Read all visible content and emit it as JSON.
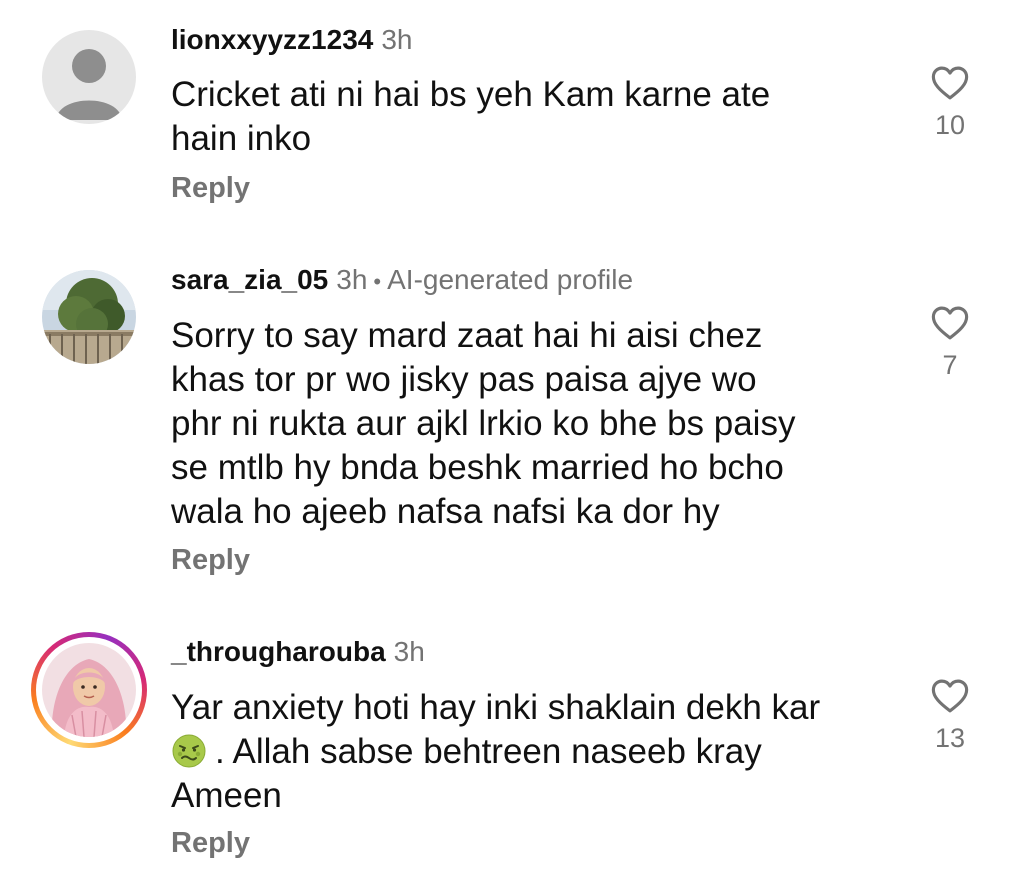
{
  "comments": [
    {
      "username": "lionxxyyzz1234",
      "time": "3h",
      "lines": [
        "Cricket ati ni hai bs yeh Kam karne ate",
        "hain inko"
      ],
      "reply_label": "Reply",
      "like_count": "10",
      "avatar": "default-avatar"
    },
    {
      "username": "sara_zia_05",
      "time": "3h",
      "separator": "•",
      "badge": "AI-generated profile",
      "lines": [
        "Sorry to say mard zaat hai hi aisi chez",
        "khas tor pr wo jisky pas paisa ajye wo",
        "phr ni rukta aur ajkl lrkio ko bhe bs paisy",
        "se mtlb hy bnda beshk married ho bcho",
        "wala ho ajeeb nafsa nafsi ka dor hy"
      ],
      "reply_label": "Reply",
      "like_count": "7",
      "avatar": "tree-photo-avatar"
    },
    {
      "username": "_througharouba",
      "time": "3h",
      "lines": [
        "Yar anxiety hoti hay inki shaklain dekh kar",
        ". Allah sabse behtreen naseeb kray",
        "Ameen"
      ],
      "emoji": "nauseated-face-emoji",
      "reply_label": "Reply",
      "like_count": "13",
      "avatar": "pink-scarf-photo-avatar",
      "story_ring": true
    }
  ],
  "colors": {
    "text_primary": "#111111",
    "text_secondary": "#737373",
    "story_ring": [
      "#feda75",
      "#fa7e1e",
      "#d62976",
      "#962fbf"
    ]
  }
}
